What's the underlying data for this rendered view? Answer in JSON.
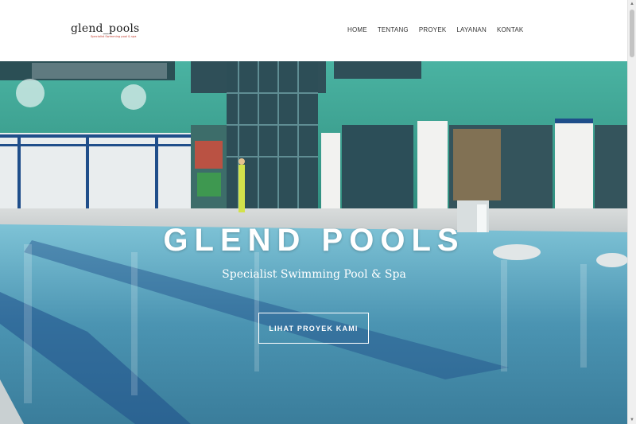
{
  "brand": {
    "logo_main": "glend",
    "logo_sep": "_",
    "logo_accent": "pools",
    "tagline": "Specialist Swimming pool & spa"
  },
  "nav": {
    "items": [
      {
        "label": "HOME"
      },
      {
        "label": "TENTANG"
      },
      {
        "label": "PROYEK"
      },
      {
        "label": "LAYANAN"
      },
      {
        "label": "KONTAK"
      }
    ]
  },
  "hero": {
    "title": "GLEND POOLS",
    "subtitle": "Specialist Swimming Pool & Spa",
    "cta_label": "LIHAT PROYEK KAMI"
  },
  "colors": {
    "accent": "#d9781f",
    "wall": "#3a9c8c",
    "water": "#4f9ab6"
  },
  "icons": {
    "scroll_up": "scroll-up-arrow-icon",
    "scroll_down": "scroll-down-arrow-icon"
  }
}
